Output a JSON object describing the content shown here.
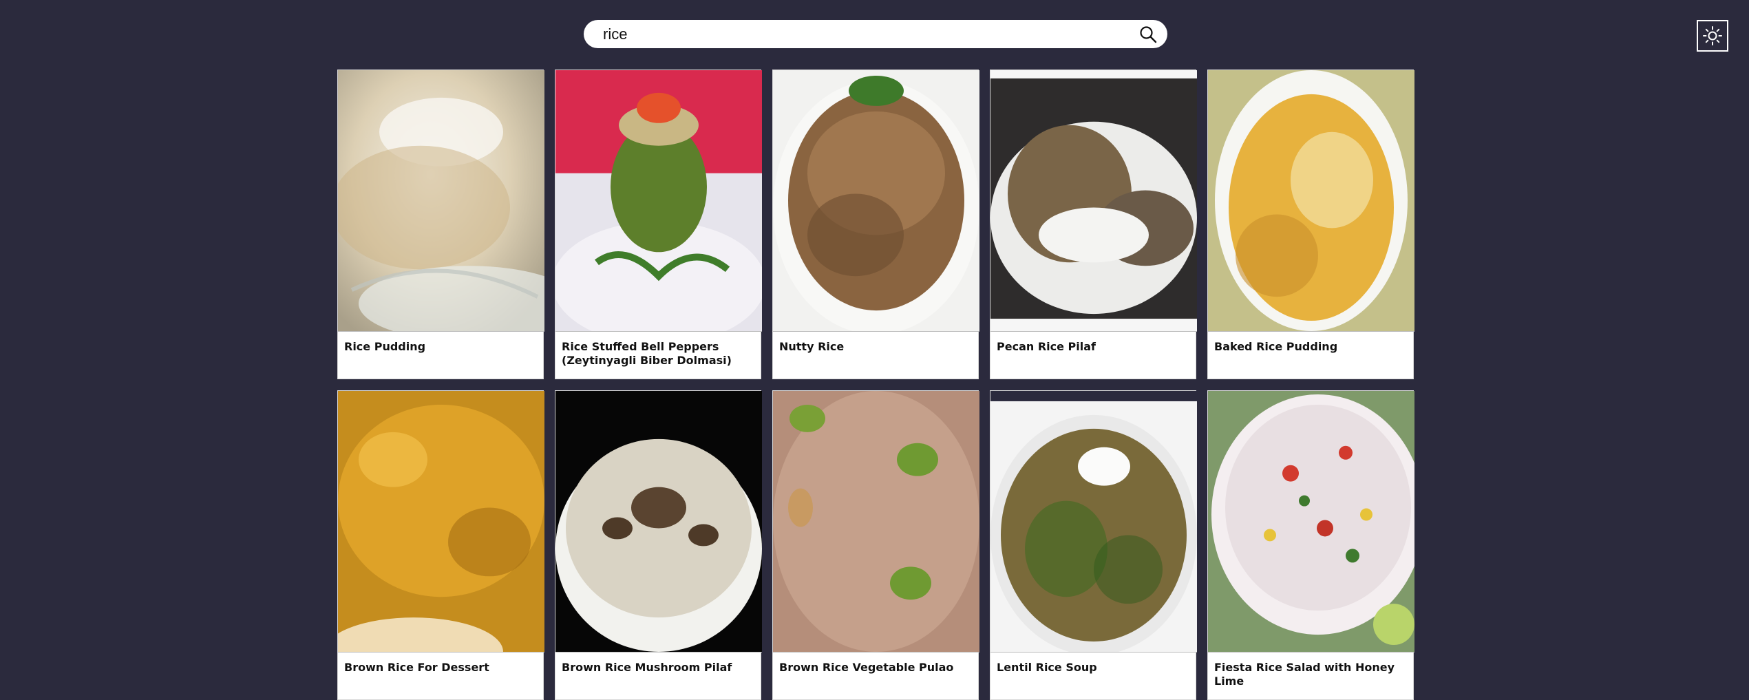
{
  "search": {
    "value": "rice",
    "button_icon": "search-icon"
  },
  "theme_toggle": {
    "icon": "sun-icon"
  },
  "recipes": [
    {
      "title": "Rice Pudding"
    },
    {
      "title": "Rice Stuffed Bell Peppers (Zeytinyagli Biber Dolmasi)"
    },
    {
      "title": "Nutty Rice"
    },
    {
      "title": "Pecan Rice Pilaf"
    },
    {
      "title": "Baked Rice Pudding"
    },
    {
      "title": "Brown Rice For Dessert"
    },
    {
      "title": "Brown Rice Mushroom Pilaf"
    },
    {
      "title": "Brown Rice Vegetable Pulao"
    },
    {
      "title": "Lentil Rice Soup"
    },
    {
      "title": "Fiesta Rice Salad with Honey Lime"
    }
  ]
}
